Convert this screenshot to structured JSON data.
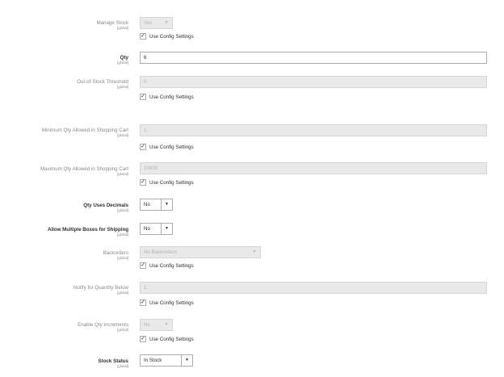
{
  "scope_label": "[global]",
  "use_config_label": "Use Config Settings",
  "check_mark": "✓",
  "dropdown_arrow": "▼",
  "fields": {
    "manage_stock": {
      "label": "Manage Stock",
      "value": "Yes"
    },
    "qty": {
      "label": "Qty",
      "value": "6"
    },
    "out_of_stock_threshold": {
      "label": "Out-of-Stock Threshold",
      "value": "0"
    },
    "min_qty_cart": {
      "label": "Minimum Qty Allowed in Shopping Cart",
      "value": "1"
    },
    "max_qty_cart": {
      "label": "Maximum Qty Allowed in Shopping Cart",
      "value": "10000"
    },
    "qty_uses_decimals": {
      "label": "Qty Uses Decimals",
      "value": "No"
    },
    "allow_multiple_boxes": {
      "label": "Allow Multiple Boxes for Shipping",
      "value": "No"
    },
    "backorders": {
      "label": "Backorders",
      "value": "No Backorders"
    },
    "notify_qty_below": {
      "label": "Notify for Quantity Below",
      "value": "1"
    },
    "enable_qty_increments": {
      "label": "Enable Qty Increments",
      "value": "No"
    },
    "stock_status": {
      "label": "Stock Status",
      "value": "In Stock"
    }
  }
}
